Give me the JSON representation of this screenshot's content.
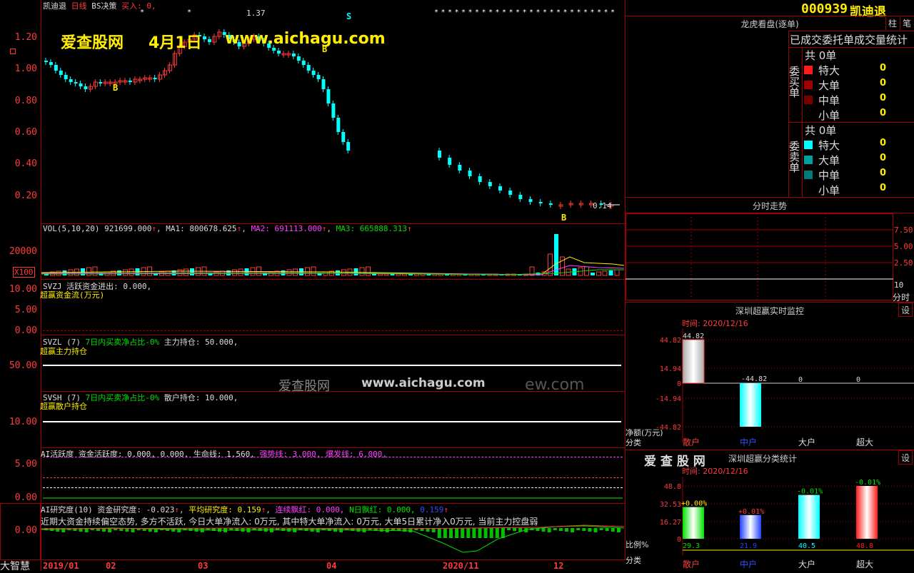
{
  "header": {
    "stock_name": "凯迪退",
    "period": "日线",
    "indicator": "BS决策",
    "buy_label": "买入: 0,",
    "code": "000939",
    "title_name": "凯迪退"
  },
  "watermark": {
    "site": "爱查股网",
    "date": "4月1日",
    "url": "www.aichagu.com",
    "center_text": "爱查股网",
    "center_url": "www.aichagu.com",
    "faded_tail": "ew.com",
    "brand": "爱 查 股 网"
  },
  "main_chart": {
    "y_ticks": [
      "1.20",
      "1.00",
      "0.80",
      "0.60",
      "0.40",
      "0.20"
    ],
    "high_label": "1.37",
    "last_label": "0.14",
    "markers": [
      "B",
      "B",
      "S",
      "B"
    ]
  },
  "vol_panel": {
    "title": "VOL(5,10,20)",
    "value": "921699.000",
    "ma1": "MA1: 800678.625",
    "ma2": "MA2: 691113.000",
    "ma3": "MA3: 665888.313",
    "y_tick": "20000",
    "unit": "X100"
  },
  "svzj": {
    "line1": "SVZJ  活跃资金进出: 0.000,",
    "line2": "超赢资金流(万元)",
    "y_ticks": [
      "10.00",
      "5.00",
      "0.00"
    ]
  },
  "svzl": {
    "prefix": "SVZL  (7)",
    "desc": "7日内买卖净占比-0%",
    "rest": "主力持仓: 50.000,",
    "line2": "超赢主力持仓",
    "y_tick": "50.00"
  },
  "svsh": {
    "prefix": "SVSH  (7)",
    "desc": "7日内买卖净占比-0%",
    "rest": "散户持仓: 10.000,",
    "line2": "超赢散户持仓",
    "y_tick": "10.00"
  },
  "ai_active": {
    "prefix": "AI活跃度  资金活跃度: 0.000, 0.000, 生命线: 1.560,",
    "strong": "强势线: 3.000,",
    "burst": "爆发线: 6.000,",
    "y_ticks": [
      "5.00",
      "0.00"
    ]
  },
  "ai_research": {
    "prefix": "AI研究度(10)  资金研究度: -0.023",
    "avg": "平均研究度: 0.159",
    "lian": "连续飘红: 0.000,",
    "nri": "N日飘红: 0.000,",
    "last": "0.159",
    "comment": "近期大资金持续偏空态势, 多方不活跃, 今日大单净流入: 0万元, 其中特大单净流入: 0万元, 大单5日累计净入0万元, 当前主力控盘弱",
    "y_tick": "0.00"
  },
  "x_axis": [
    "2019/01",
    "02",
    "03",
    "04",
    "2020/11",
    "12"
  ],
  "bottom_left": "大智慧",
  "right_panel": {
    "btn_zhu": "柱",
    "btn_bi": "笔",
    "longhu_title": "龙虎看盘(逐单)",
    "stats_title": "已成交委托单成交量统计",
    "buy_side": "委买单",
    "sell_side": "委卖单",
    "buy_total": "共 0单",
    "sell_total": "共 0单",
    "buy_rows": [
      {
        "label": "特大",
        "value": "0",
        "color": "#ff1a1a"
      },
      {
        "label": "大单",
        "value": "0",
        "color": "#a00000"
      },
      {
        "label": "中单",
        "value": "0",
        "color": "#7a0000"
      },
      {
        "label": "小单",
        "value": "0",
        "color": "#000000"
      }
    ],
    "sell_rows": [
      {
        "label": "特大",
        "value": "0",
        "color": "#00ffff"
      },
      {
        "label": "大单",
        "value": "0",
        "color": "#00a0a0"
      },
      {
        "label": "中单",
        "value": "0",
        "color": "#007a7a"
      },
      {
        "label": "小单",
        "value": "0",
        "color": "#000000"
      }
    ],
    "fenshi_title": "分时走势",
    "fenshi_y": [
      "7.50",
      "5.00",
      "2.50"
    ],
    "fenshi_bottom_left": "10",
    "fenshi_unit": "分时",
    "monitor_title": "深圳超赢实时监控",
    "monitor_set": "设",
    "monitor_time": "时间: 2020/12/16",
    "monitor_y": [
      "44.82",
      "14.94",
      "0",
      "-14.94",
      "-44.82"
    ],
    "monitor_labels": [
      "44.82",
      "-44.82",
      "0",
      "0"
    ],
    "monitor_unit": "净额(万元)",
    "monitor_cat_label": "分类",
    "categories": [
      "散户",
      "中户",
      "大户",
      "超大"
    ],
    "classify_title": "深圳超赢分类统计",
    "classify_set": "设",
    "classify_time": "时间: 2020/12/16",
    "classify_y": [
      "48.8",
      "32.53",
      "16.27",
      "0"
    ],
    "classify_pct_labels": [
      "+0.00%",
      "+0.01%",
      "-0.01%",
      "-0.01%"
    ],
    "classify_values": [
      "29.3",
      "21.9",
      "40.5",
      "48.8"
    ],
    "ratio_label": "比例%",
    "classify_cat_label": "分类"
  },
  "chart_data": [
    {
      "type": "bar",
      "title": "深圳超赢实时监控",
      "categories": [
        "散户",
        "中户",
        "大户",
        "超大"
      ],
      "values": [
        44.82,
        -44.82,
        0,
        0
      ],
      "ylim": [
        -44.82,
        44.82
      ]
    },
    {
      "type": "bar",
      "title": "深圳超赢分类统计",
      "categories": [
        "散户",
        "中户",
        "大户",
        "超大"
      ],
      "values": [
        29.3,
        21.9,
        40.5,
        48.8
      ],
      "ylim": [
        0,
        48.8
      ]
    }
  ]
}
